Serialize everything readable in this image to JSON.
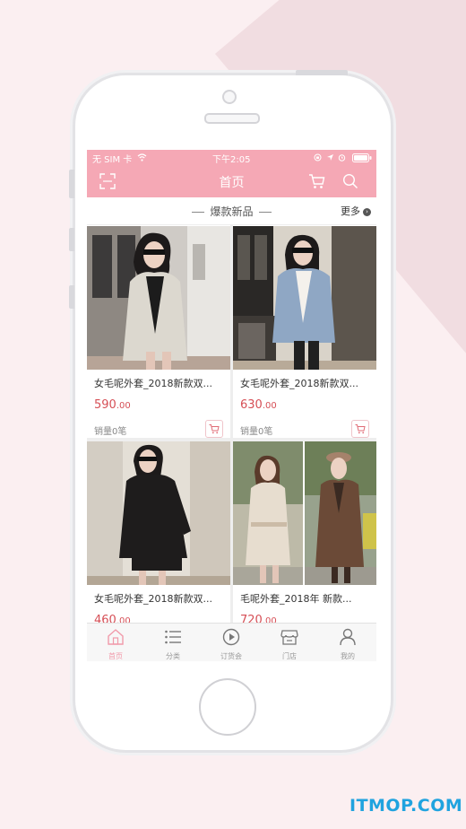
{
  "status_bar": {
    "carrier": "无 SIM 卡",
    "time": "下午2:05"
  },
  "nav": {
    "title": "首页"
  },
  "section": {
    "title": "爆款新品",
    "more": "更多"
  },
  "products": [
    {
      "name": "女毛呢外套_2018新款双...",
      "price_int": "590",
      "price_dec": ".00",
      "sales": "销量0笔"
    },
    {
      "name": "女毛呢外套_2018新款双...",
      "price_int": "630",
      "price_dec": ".00",
      "sales": "销量0笔"
    },
    {
      "name": "女毛呢外套_2018新款双...",
      "price_int": "460",
      "price_dec": ".00",
      "sales": ""
    },
    {
      "name": "毛呢外套_2018年 新款...",
      "price_int": "720",
      "price_dec": ".00",
      "sales": ""
    }
  ],
  "tabs": [
    {
      "label": "首页",
      "icon": "home-icon",
      "active": true
    },
    {
      "label": "分类",
      "icon": "list-icon",
      "active": false
    },
    {
      "label": "订货会",
      "icon": "play-icon",
      "active": false
    },
    {
      "label": "门店",
      "icon": "store-icon",
      "active": false
    },
    {
      "label": "我的",
      "icon": "user-icon",
      "active": false
    }
  ],
  "watermark": "ITMOP.COM",
  "colors": {
    "accent": "#f5a8b5",
    "price": "#d64f56",
    "tab_active": "#f19aaa"
  }
}
